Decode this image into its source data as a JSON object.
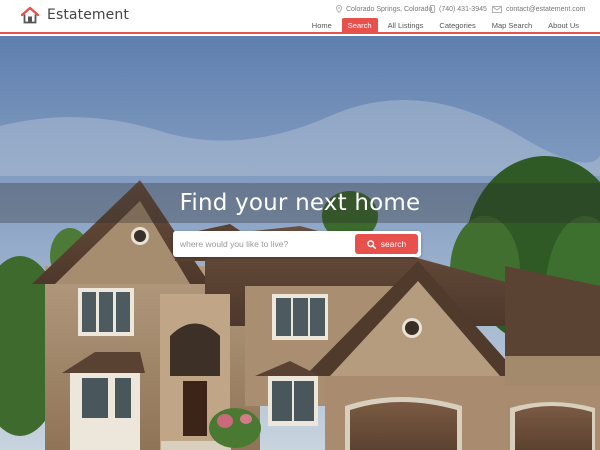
{
  "brand": {
    "name": "Estatement",
    "logo_icon": "house-icon"
  },
  "contact": {
    "location": "Colorado Springs, Colorado",
    "phone": "(740) 431-3945",
    "email": "contact@estatement.com"
  },
  "nav": {
    "items": [
      {
        "label": "Home",
        "active": false
      },
      {
        "label": "Search",
        "active": true
      },
      {
        "label": "All Listings",
        "active": false
      },
      {
        "label": "Categories",
        "active": false
      },
      {
        "label": "Map Search",
        "active": false
      },
      {
        "label": "About Us",
        "active": false
      }
    ]
  },
  "hero": {
    "headline": "Find your next home",
    "search": {
      "placeholder": "where would you like to live?",
      "value": "",
      "button_label": "search",
      "button_icon": "search-icon"
    }
  },
  "colors": {
    "accent": "#e8504c",
    "text": "#555555"
  }
}
